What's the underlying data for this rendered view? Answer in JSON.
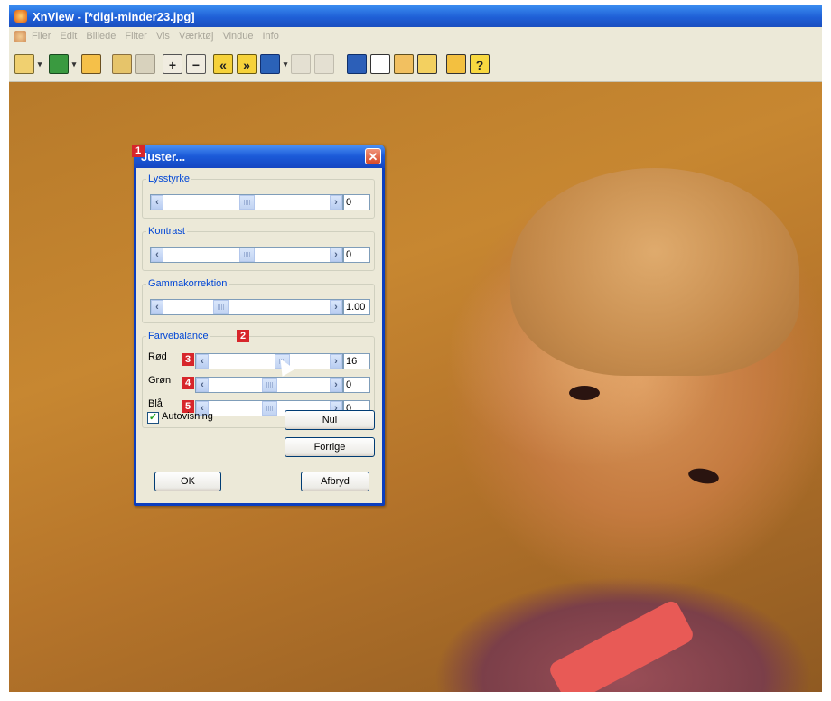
{
  "window": {
    "title": "XnView - [*digi-minder23.jpg]"
  },
  "menu": [
    "Filer",
    "Edit",
    "Billede",
    "Filter",
    "Vis",
    "Værktøj",
    "Vindue",
    "Info"
  ],
  "toolbar": {
    "icons": [
      "browser-icon",
      "open-icon",
      "acquire-icon",
      "save-icon",
      "film-icon",
      "zoom-in-icon",
      "zoom-out-icon",
      "previous-icon",
      "next-icon",
      "refresh-icon",
      "page1-icon",
      "page2-icon",
      "fullscreen-icon",
      "print-icon",
      "slideshow-icon",
      "capture-icon",
      "settings-icon",
      "help-icon"
    ],
    "help_label": "?"
  },
  "dialog": {
    "title": "Juster...",
    "close_label": "✕",
    "brightness": {
      "label": "Lysstyrke",
      "value": "0",
      "position": 0.5
    },
    "contrast": {
      "label": "Kontrast",
      "value": "0",
      "position": 0.5
    },
    "gamma": {
      "label": "Gammakorrektion",
      "value": "1.00",
      "position": 0.33
    },
    "color_balance": {
      "label": "Farvebalance",
      "red": {
        "label": "Rød",
        "value": "16",
        "position": 0.62
      },
      "green": {
        "label": "Grøn",
        "value": "0",
        "position": 0.5
      },
      "blue": {
        "label": "Blå",
        "value": "0",
        "position": 0.5
      }
    },
    "autopreview": {
      "label": "Autovisning",
      "checked": true
    },
    "buttons": {
      "reset": "Nul",
      "previous": "Forrige",
      "ok": "OK",
      "cancel": "Afbryd"
    }
  },
  "badges": [
    "1",
    "2",
    "3",
    "4",
    "5"
  ]
}
